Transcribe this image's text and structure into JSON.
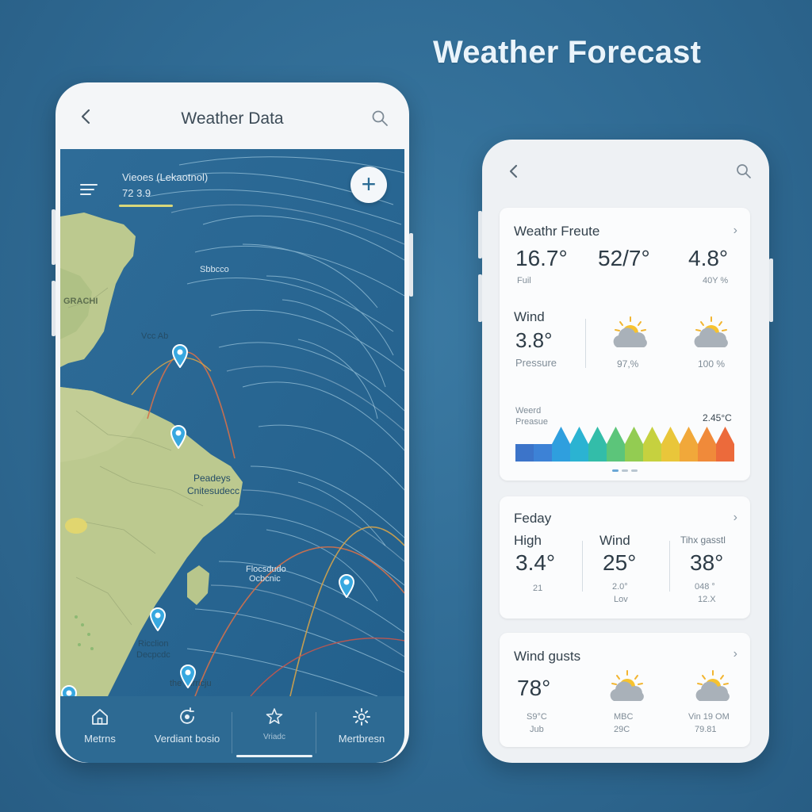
{
  "headline": "Weather Forecast",
  "left_phone": {
    "header": {
      "title": "Weather Data",
      "back_icon": "chevron-left-icon",
      "search_icon": "search-icon"
    },
    "map": {
      "overlay_label": "Vieoes (Lekaotnol)",
      "overlay_value": "72 3.9",
      "labels": {
        "ocean_top": "Sbbcco",
        "greenland": "GRACHI",
        "north_label": "Vcc Ab",
        "south_america_1": "Peadeys",
        "south_america_2": "Cnitesudecc",
        "ocean_mid_1": "Flocsdudo",
        "ocean_mid_2": "Ocbcnic",
        "south_1": "Ricclion",
        "south_2": "Decpcdc",
        "bottom": "the Nirricju"
      }
    },
    "nav": [
      {
        "label": "Metrns",
        "icon": "home-icon"
      },
      {
        "label": "Verdiant bosio",
        "icon": "refresh-icon"
      },
      {
        "label": "Vriadc",
        "icon": "star-icon"
      },
      {
        "label": "Mertbresn",
        "icon": "gear-icon"
      }
    ]
  },
  "right_phone": {
    "header": {
      "back_icon": "chevron-left-icon",
      "search_icon": "search-icon"
    },
    "card1": {
      "title": "Weathr Freute",
      "temps": [
        "16.7°",
        "52/7°",
        "4.8°"
      ],
      "sub_left": "Fuil",
      "sub_right": "40Y %",
      "wind_label": "Wind",
      "wind_value": "3.8°",
      "pressure_label": "Pressure",
      "pct_1": "97,%",
      "pct_2": "100 %",
      "chart_label_1": "Weerd",
      "chart_label_2": "Preasue",
      "chart_value": "2.45°C",
      "chart_colors": [
        "#3c74c9",
        "#3d82d6",
        "#2f9fde",
        "#2bb3d2",
        "#33bda9",
        "#5cc57a",
        "#93cc52",
        "#c6d13f",
        "#e9c63a",
        "#f1a83a",
        "#f08a3a",
        "#ec6a3b"
      ]
    },
    "card2": {
      "title": "Feday",
      "col1_label": "High",
      "col1_value": "3.4°",
      "col1_sub": "21",
      "col2_label": "Wind",
      "col2_value": "25°",
      "col2_sub1": "2.0°",
      "col2_sub2": "Lov",
      "col3_label": "Tihx gasstl",
      "col3_value": "38°",
      "col3_sub1": "048 °",
      "col3_sub2": "12.X"
    },
    "card3": {
      "title": "Wind gusts",
      "value": "78°",
      "sub1": "S9°C",
      "sub1b": "Jub",
      "sub2": "MBC",
      "sub2b": "29C",
      "sub3": "Vin 19 OM",
      "sub3b": "79.81"
    }
  }
}
